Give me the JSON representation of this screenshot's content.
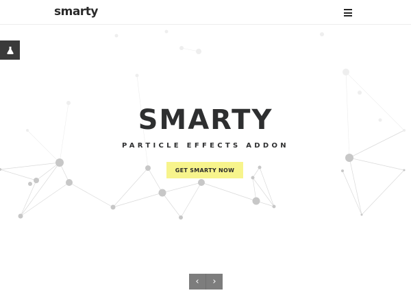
{
  "header": {
    "logo_text": "smarty",
    "menu_icon": "hamburger-menu-icon"
  },
  "sidebar_tool": {
    "icon": "flask-icon"
  },
  "hero": {
    "title": "SMARTY",
    "subtitle": "PARTICLE EFFECTS ADDON",
    "cta_label": "GET SMARTY NOW",
    "cta_color": "#f7f48c"
  },
  "slider": {
    "prev_icon": "chevron-left-icon",
    "prev_glyph": "‹",
    "next_icon": "chevron-right-icon",
    "next_glyph": "›",
    "control_color": "#7d7d7d"
  },
  "particles": {
    "node_color": "#c9c9c9",
    "line_color": "#d8d8d8"
  }
}
